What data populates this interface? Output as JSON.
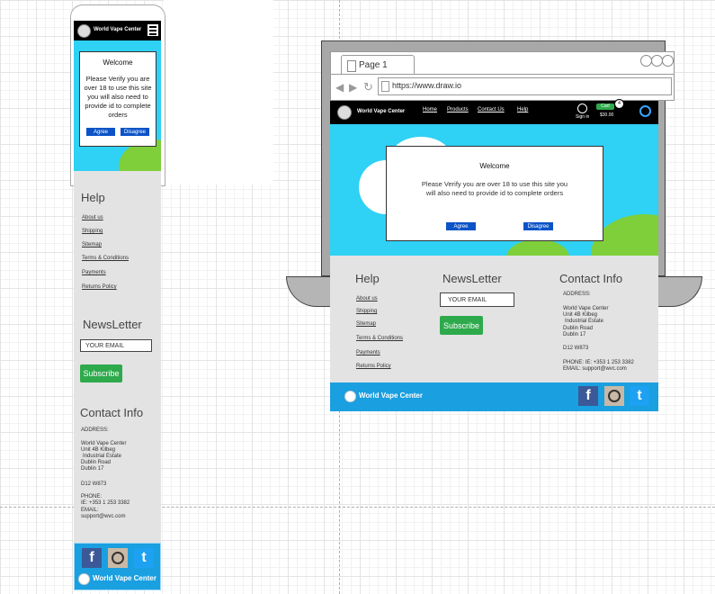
{
  "brand": "World Vape Center",
  "popup": {
    "title": "Welcome",
    "message": "Please Verify you are over 18 to use this site you will also need to provide id to complete orders",
    "agree": "Agree",
    "disagree": "Disagree"
  },
  "help": {
    "title": "Help",
    "links": [
      "About us",
      "Shipping",
      "Sitemap",
      "Terms & Conditions",
      "Payments",
      "Returns Policy"
    ]
  },
  "newsletter": {
    "title": "NewsLetter",
    "placeholder": "YOUR EMAIL",
    "button": "Subscribe"
  },
  "contact": {
    "title": "Contact Info",
    "address_label": "ADDRESS:",
    "address_lines": [
      "World Vape Center",
      "Unit 4B Kilbeg",
      "Industrial Estate",
      "Dublin Road",
      "Dublin 17"
    ],
    "eircode": "D12 W873",
    "phone_label": "PHONE:",
    "phone": "IE: +353 1 253 3382",
    "email_label": "EMAIL:",
    "email": "support@wvc.com",
    "phone_inline": "PHONE: IE: +353 1 253 3382",
    "email_inline": "EMAIL: support@wvc.com"
  },
  "browser": {
    "tab": "Page 1",
    "url": "https://www.draw.io"
  },
  "nav": [
    "Home",
    "Products",
    "Contact Us",
    "Help"
  ],
  "header": {
    "signin": "Sign in",
    "cart": "Cart",
    "cart_count": "4",
    "cart_total": "$30.00"
  },
  "colors": {
    "accent_blue": "#1a9fe0",
    "sky": "#2fd1f5",
    "green_button": "#2eaa4c",
    "header_black": "#000000",
    "footer_gray": "#e3e3e3"
  },
  "icons": [
    "menu-icon",
    "facebook-icon",
    "instagram-icon",
    "twitter-icon",
    "search-icon",
    "user-icon",
    "logo-icon"
  ]
}
